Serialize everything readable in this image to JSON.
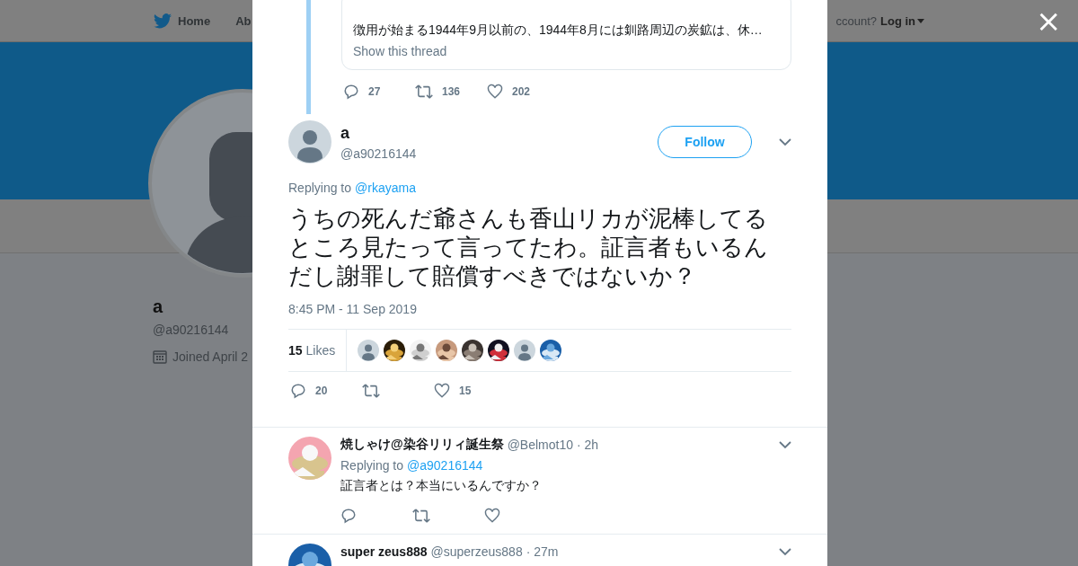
{
  "background": {
    "nav": {
      "items": [
        {
          "label": "Home"
        },
        {
          "label": "Ab"
        }
      ],
      "account_prompt": "ccount?",
      "login": "Log in"
    },
    "profile": {
      "name": "a",
      "handle": "@a90216144",
      "joined": "Joined April 2"
    }
  },
  "modal": {
    "close": "×",
    "quoted_thread": {
      "text": "徴用が始まる1944年9月以前の、1944年8月には釧路周辺の炭鉱は、休…",
      "show_thread": "Show this thread",
      "replies": "27",
      "retweets": "136",
      "likes": "202"
    },
    "tweet": {
      "name": "a",
      "handle": "@a90216144",
      "follow": "Follow",
      "replying_label": "Replying to",
      "replying_to": "@rkayama",
      "text": "うちの死んだ爺さんも香山リカが泥棒してるところ見たって言ってたわ。証言者もいるんだし謝罪して賠償すべきではないか？",
      "timestamp": "8:45 PM - 11 Sep 2019",
      "like_count": "15",
      "like_label": "Likes",
      "likers": [
        {
          "kind": "default"
        },
        {
          "kind": "picture"
        },
        {
          "kind": "picture"
        },
        {
          "kind": "picture"
        },
        {
          "kind": "picture"
        },
        {
          "kind": "picture"
        },
        {
          "kind": "default"
        },
        {
          "kind": "picture"
        }
      ],
      "replies": "20",
      "likes": "15"
    },
    "replies": [
      {
        "name": "焼しゃけ@染谷リリィ誕生祭",
        "handle": "@Belmot10",
        "time": "· 2h",
        "replying_label": "Replying to",
        "replying_to": "@a90216144",
        "text": "証言者とは？本当にいるんですか？"
      },
      {
        "name": "super zeus888",
        "handle": "@superzeus888",
        "time": "· 27m"
      }
    ]
  }
}
